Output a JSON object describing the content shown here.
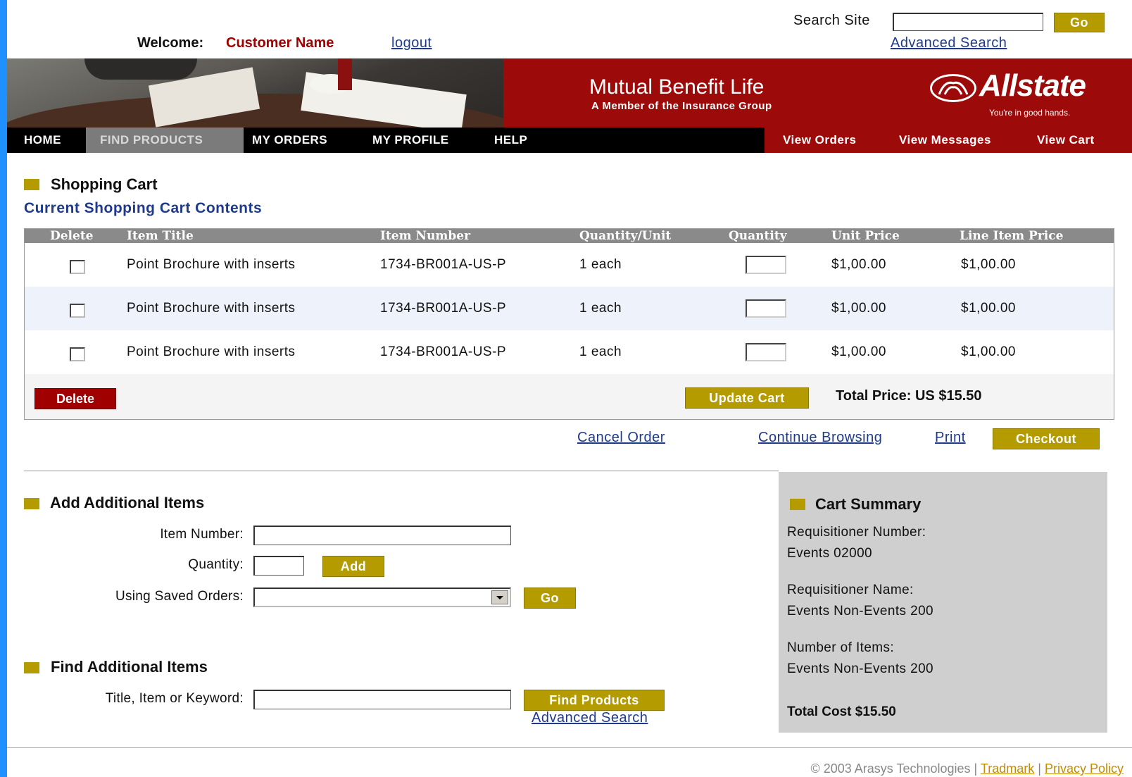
{
  "header": {
    "search_label": "Search Site",
    "search_value": "",
    "go_label": "Go",
    "advanced_search": "Advanced Search",
    "welcome_label": "Welcome:",
    "customer_name": "Customer Name",
    "logout": "logout"
  },
  "banner": {
    "company": "Mutual Benefit Life",
    "tagline": "A Member of the Insurance Group",
    "brand": "Allstate",
    "brand_tagline": "You're in good hands."
  },
  "nav": {
    "items": [
      "HOME",
      "FIND PRODUCTS",
      "MY ORDERS",
      "MY PROFILE",
      "HELP"
    ],
    "active": "FIND PRODUCTS",
    "right_items": [
      "View Orders",
      "View Messages",
      "View Cart"
    ]
  },
  "cart": {
    "title": "Shopping Cart",
    "subtitle": "Current Shopping Cart Contents",
    "columns": [
      "Delete",
      "Item Title",
      "Item Number",
      "Quantity/Unit",
      "Quantity",
      "Unit Price",
      "Line Item Price"
    ],
    "rows": [
      {
        "title": "Point Brochure with inserts",
        "number": "1734-BR001A-US-P",
        "unit": "1 each",
        "unit_price": "$1,00.00",
        "line_price": "$1,00.00"
      },
      {
        "title": "Point Brochure with inserts",
        "number": "1734-BR001A-US-P",
        "unit": "1 each",
        "unit_price": "$1,00.00",
        "line_price": "$1,00.00"
      },
      {
        "title": "Point Brochure with inserts",
        "number": "1734-BR001A-US-P",
        "unit": "1 each",
        "unit_price": "$1,00.00",
        "line_price": "$1,00.00"
      }
    ],
    "delete_button": "Delete",
    "update_button": "Update Cart",
    "total": "Total Price: US $15.50",
    "cancel_order": "Cancel Order",
    "continue_browsing": "Continue Browsing",
    "print": "Print",
    "checkout": "Checkout"
  },
  "add_items": {
    "title": "Add Additional Items",
    "item_number_label": "Item Number:",
    "quantity_label": "Quantity:",
    "add_button": "Add",
    "saved_orders_label": "Using Saved Orders:",
    "go_button": "Go"
  },
  "find_items": {
    "title": "Find Additional Items",
    "keyword_label": "Title, Item or Keyword:",
    "find_button": "Find Products",
    "advanced_search": "Advanced Search"
  },
  "summary": {
    "title": "Cart Summary",
    "req_number_label": "Requisitioner Number:",
    "req_number": "Events 02000",
    "req_name_label": "Requisitioner Name:",
    "req_name": "Events Non-Events 200",
    "items_label": "Number of Items:",
    "items_value": "Events Non-Events 200",
    "total_cost": "Total Cost $15.50"
  },
  "footer": {
    "copyright": "© 2003 Arasys Technologies |",
    "trademark": "Tradmark",
    "sep": "|",
    "privacy": "Privacy Policy"
  }
}
